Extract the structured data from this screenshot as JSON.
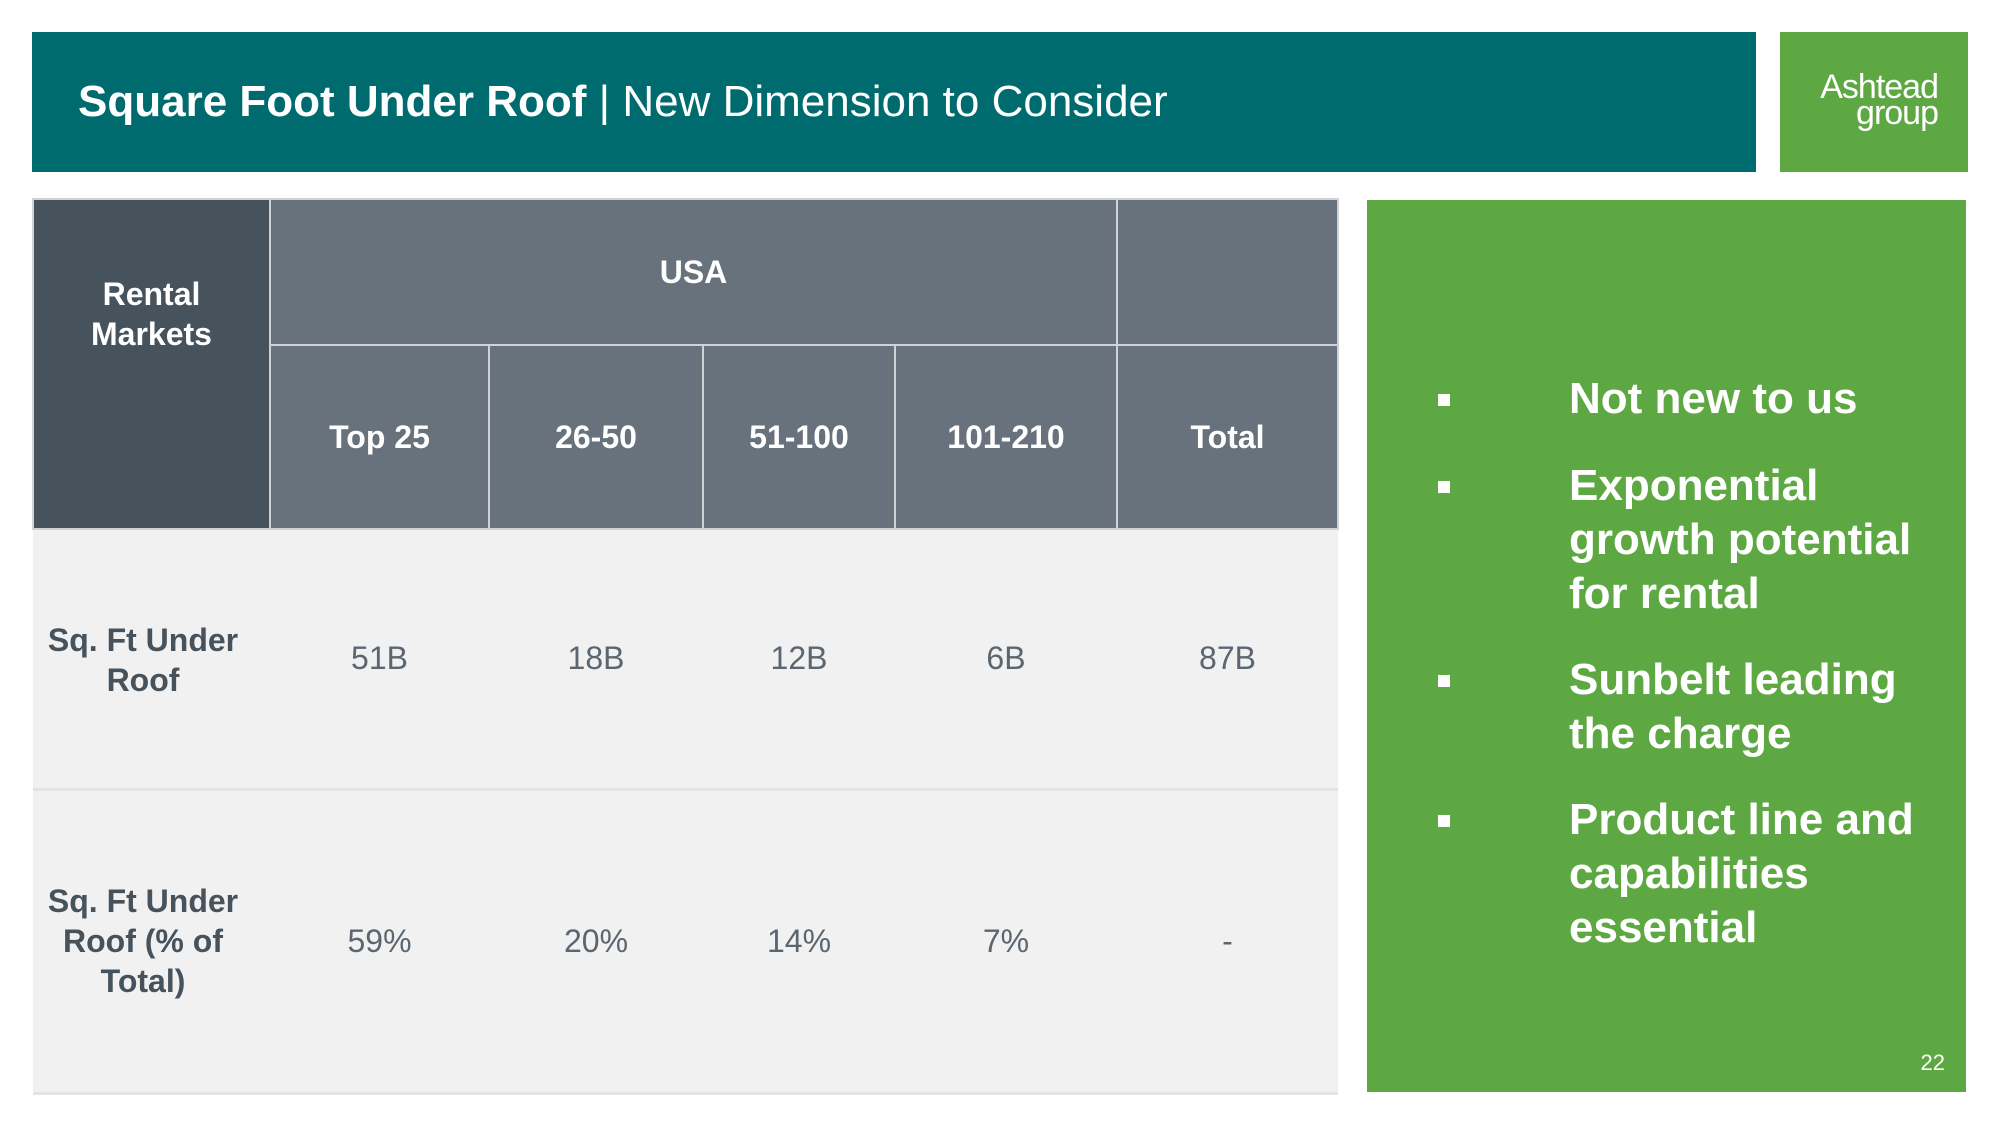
{
  "header": {
    "title_bold": "Square Foot Under Roof",
    "separator": " | ",
    "title_rest": "New Dimension to Consider"
  },
  "logo": {
    "line1": "Ashtead",
    "line2": "group"
  },
  "colors": {
    "teal": "#006b6e",
    "green": "#5ea843",
    "header_dark": "#46525c",
    "header_mid": "#67727c",
    "body_bg": "#f1f1f1"
  },
  "table": {
    "corner_label": "Rental Markets",
    "group_label": "USA",
    "columns": [
      "Top 25",
      "26-50",
      "51-100",
      "101-210",
      "Total"
    ],
    "rows": [
      {
        "label": "Sq. Ft Under Roof",
        "values": [
          "51B",
          "18B",
          "12B",
          "6B",
          "87B"
        ]
      },
      {
        "label": "Sq. Ft Under Roof (% of Total)",
        "values": [
          "59%",
          "20%",
          "14%",
          "7%",
          "-"
        ]
      }
    ]
  },
  "bullets": [
    "Not new to us",
    "Exponential growth potential for rental",
    "Sunbelt leading the charge",
    "Product line and capabilities essential"
  ],
  "page_number": "22"
}
